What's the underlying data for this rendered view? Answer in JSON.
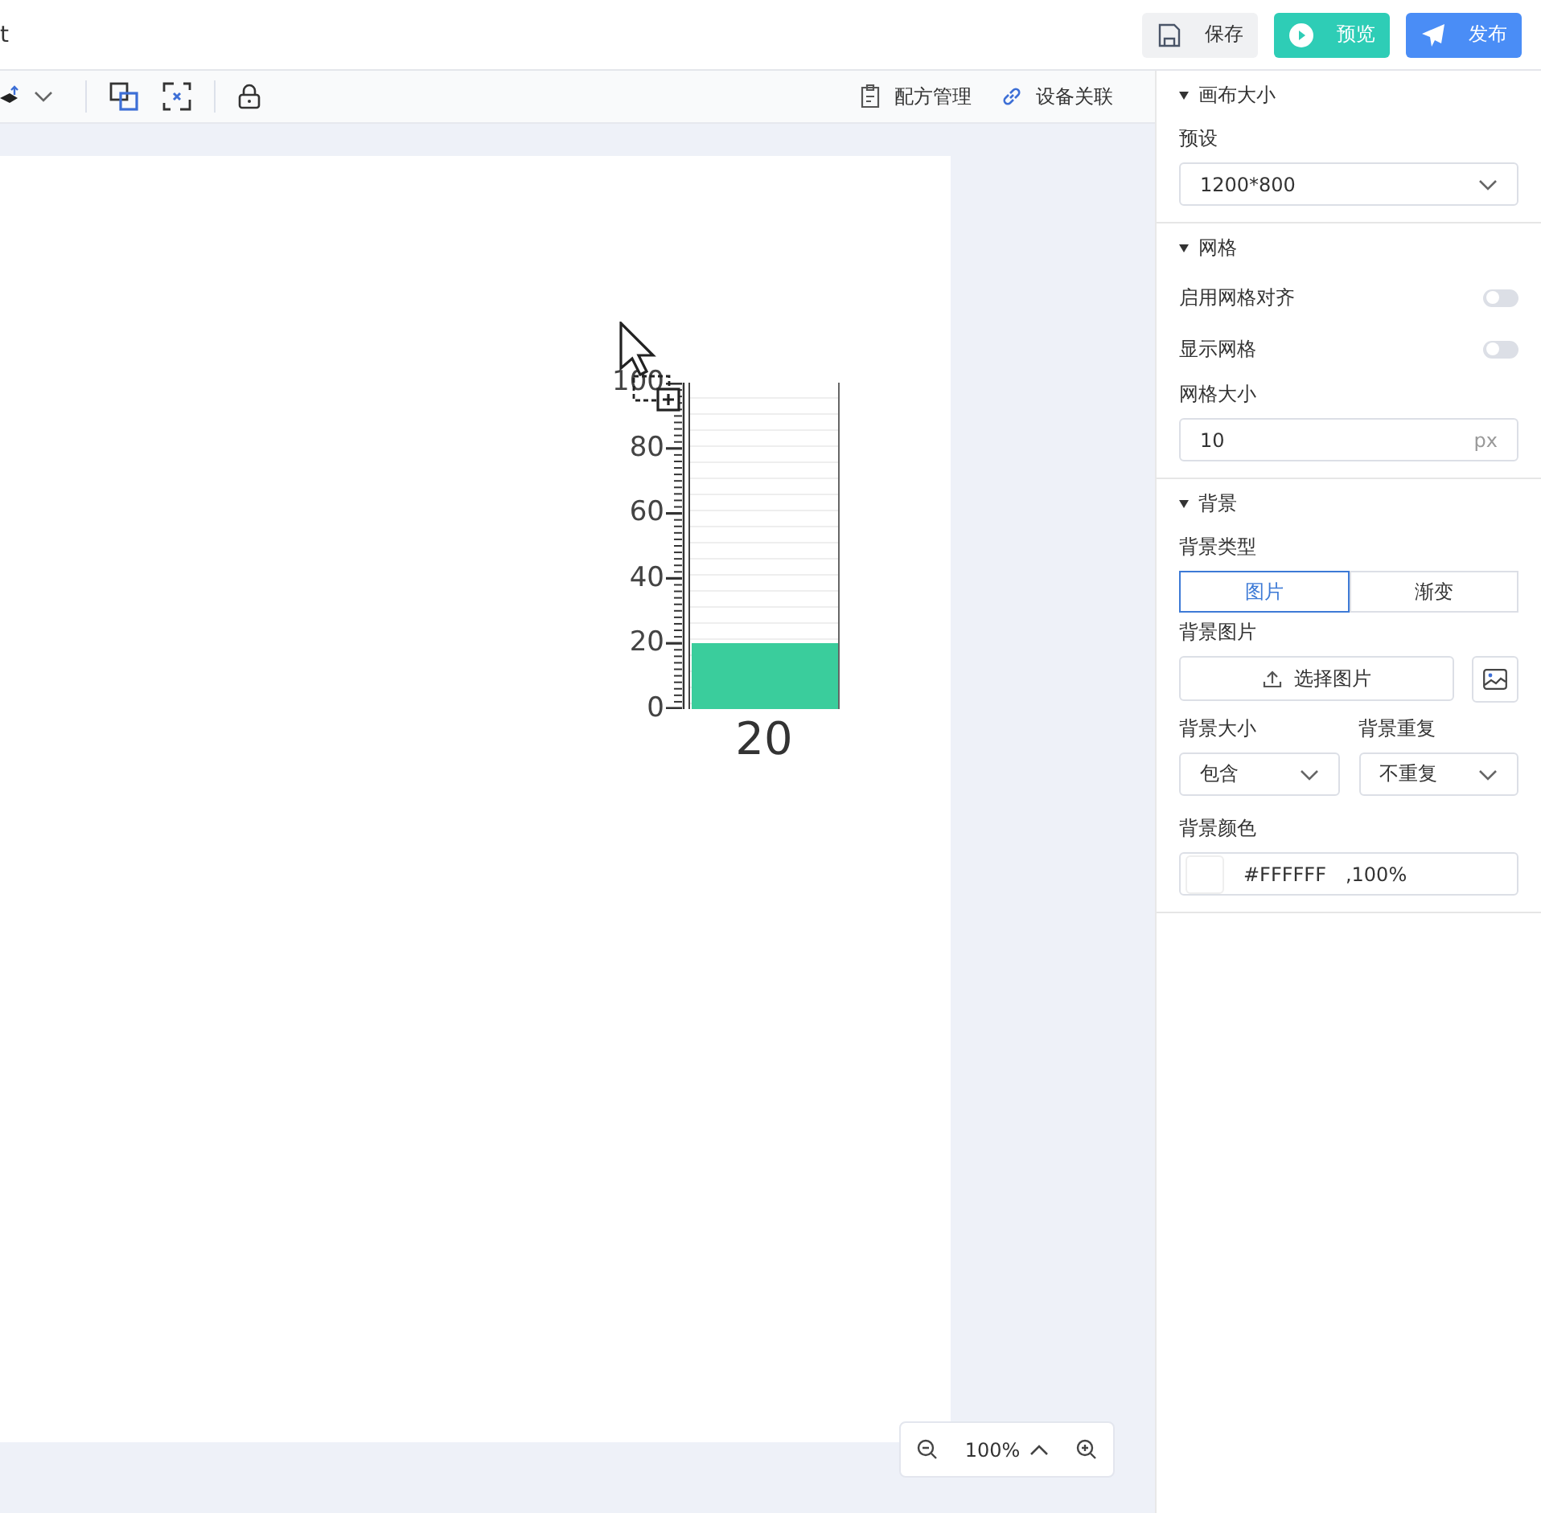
{
  "header": {
    "cut_title": "t",
    "buttons": [
      {
        "kind": "save",
        "label": "保存"
      },
      {
        "kind": "preview",
        "label": "预览"
      },
      {
        "kind": "publish",
        "label": "发布"
      }
    ]
  },
  "toolbar": {
    "links": [
      {
        "kind": "recipe",
        "label": "配方管理"
      },
      {
        "kind": "device",
        "label": "设备关联"
      }
    ]
  },
  "canvas": {
    "gauge": {
      "ticks": [
        "100",
        "80",
        "60",
        "40",
        "20",
        "0"
      ],
      "level": 0.2,
      "reading": "20"
    }
  },
  "zoom": {
    "value": "100%"
  },
  "panel": {
    "sections": [
      {
        "title": "画布大小",
        "expanded": true,
        "fields": [
          {
            "kind": "select",
            "label": "预设",
            "value": "1200*800"
          }
        ]
      },
      {
        "title": "网格",
        "expanded": true,
        "fields": [
          {
            "kind": "toggle",
            "label": "启用网格对齐",
            "on": false
          },
          {
            "kind": "toggle",
            "label": "显示网格",
            "on": false
          },
          {
            "kind": "input",
            "label": "网格大小",
            "value": "10",
            "suffix": "px"
          }
        ]
      },
      {
        "title": "背景",
        "expanded": true,
        "fields": [
          {
            "kind": "segmented",
            "label": "背景类型",
            "options": [
              {
                "label": "图片",
                "selected": true
              },
              {
                "label": "渐变",
                "selected": false
              }
            ]
          },
          {
            "kind": "upload",
            "label": "背景图片",
            "button": "选择图片"
          },
          {
            "kind": "select_pair",
            "items": [
              {
                "label": "背景大小",
                "value": "包含"
              },
              {
                "label": "背景重复",
                "value": "不重复"
              }
            ]
          },
          {
            "kind": "color",
            "label": "背景颜色",
            "color": "#ffffff",
            "value": "#FFFFFF",
            "alpha": ",100%"
          }
        ]
      }
    ]
  }
}
